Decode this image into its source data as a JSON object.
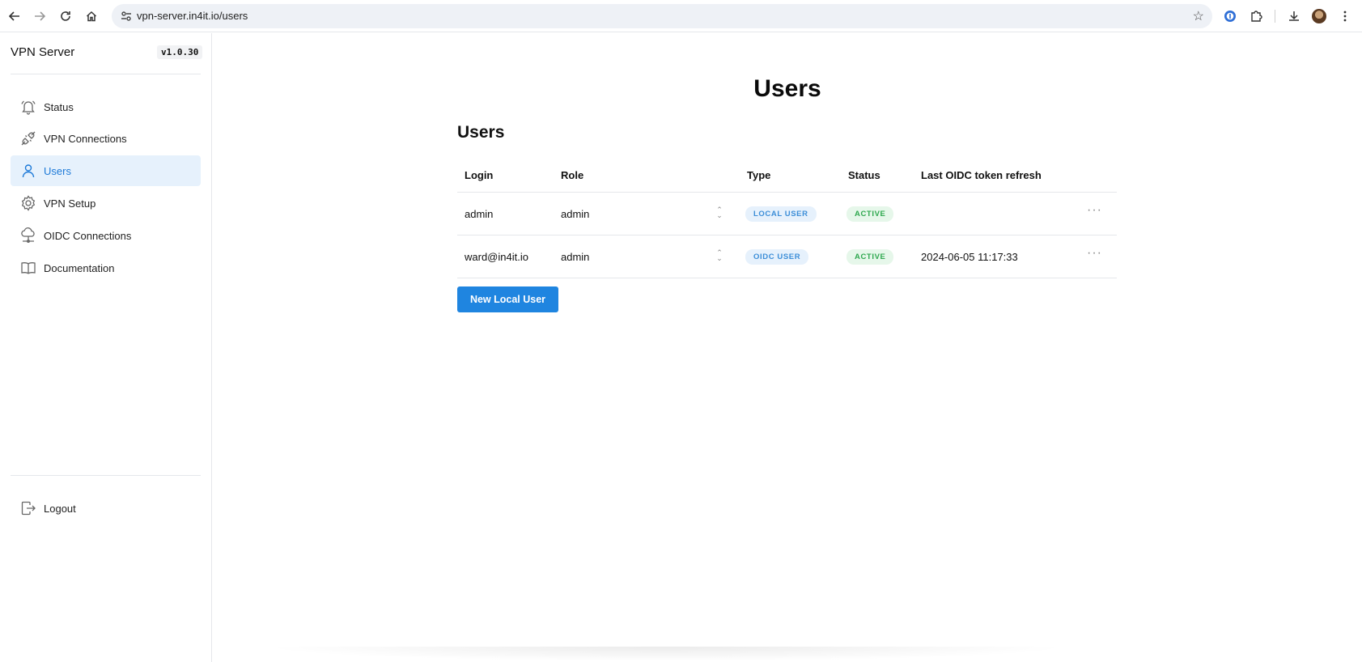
{
  "browser": {
    "url": "vpn-server.in4it.io/users"
  },
  "sidebar": {
    "brand": "VPN Server",
    "version": "v1.0.30",
    "items": [
      {
        "label": "Status"
      },
      {
        "label": "VPN Connections"
      },
      {
        "label": "Users"
      },
      {
        "label": "VPN Setup"
      },
      {
        "label": "OIDC Connections"
      },
      {
        "label": "Documentation"
      }
    ],
    "logout": "Logout"
  },
  "main": {
    "page_title": "Users",
    "section_title": "Users",
    "table": {
      "headers": [
        "Login",
        "Role",
        "Type",
        "Status",
        "Last OIDC token refresh"
      ],
      "rows": [
        {
          "login": "admin",
          "role": "admin",
          "type": "LOCAL USER",
          "status": "ACTIVE",
          "last_refresh": ""
        },
        {
          "login": "ward@in4it.io",
          "role": "admin",
          "type": "OIDC USER",
          "status": "ACTIVE",
          "last_refresh": "2024-06-05 11:17:33"
        }
      ]
    },
    "new_user_button": "New Local User"
  },
  "colors": {
    "accent": "#1f85e0",
    "active_nav_bg": "#e6f1fc",
    "status_active": "#2fa84f"
  }
}
